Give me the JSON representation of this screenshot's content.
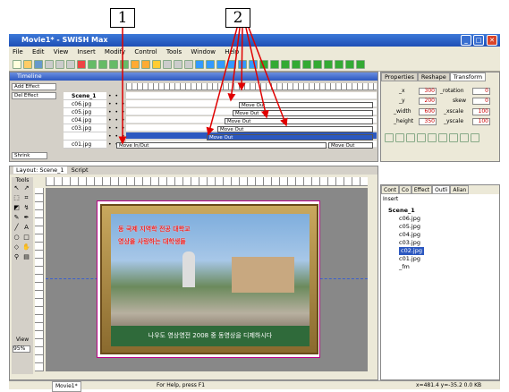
{
  "window": {
    "title": "Movie1* - SWiSH Max"
  },
  "menu": [
    "File",
    "Edit",
    "View",
    "Insert",
    "Modify",
    "Control",
    "Tools",
    "Window",
    "Help"
  ],
  "timeline": {
    "tab": "Timeline",
    "add_effect": "Add Effect",
    "del_effect": "Del Effect",
    "shrink": "Shrink",
    "scene": "Scene_1",
    "layers": [
      "c06.jpg",
      "c05.jpg",
      "c04.jpg",
      "c03.jpg",
      "c02.jpg",
      "c01.jpg"
    ],
    "effects": [
      "Move Out",
      "Move Out",
      "Move Out",
      "Move Out",
      "Move Out",
      "Move In/Out",
      "Move Out"
    ]
  },
  "properties": {
    "tabs": [
      "Properties",
      "Reshape",
      "Transform"
    ],
    "x_label": "_x",
    "y_label": "_y",
    "w_label": "_width",
    "h_label": "_height",
    "rot_label": "_rotation",
    "skew_label": "skew",
    "xs_label": "_xscale",
    "ys_label": "_yscale",
    "x": "300",
    "y": "200",
    "width": "600",
    "height": "350",
    "rotation": "0",
    "skew": "0",
    "xscale": "100",
    "yscale": "100"
  },
  "layout": {
    "tabs": [
      "Layout: Scene_1",
      "Script"
    ],
    "tools_label": "Tools",
    "view_label": "View",
    "zoom": "95%",
    "photo_texts": [
      "동 국제 지역학 전공 대학교",
      "영상을 사랑하는 대학생들",
      "나우도 영상영전 2008 중 동영상을 디제하시다"
    ]
  },
  "objects": {
    "tabs": [
      "Cont",
      "Co",
      "Effect",
      "Outli",
      "Alian"
    ],
    "insert": "Insert",
    "scene": "Scene_1",
    "items": [
      "c06.jpg",
      "c05.jpg",
      "c04.jpg",
      "c03.jpg",
      "c02.jpg",
      "c01.jpg",
      "_fm"
    ]
  },
  "status": {
    "tab": "Movie1*",
    "help": "For Help, press F1",
    "coords": "x=481.4 y=-35.2 0.0 KB"
  },
  "callouts": {
    "one": "1",
    "two": "2"
  },
  "colors": {
    "title": "#1f4fb5",
    "arrow": "#e00000",
    "selection": "#2c58c0"
  }
}
